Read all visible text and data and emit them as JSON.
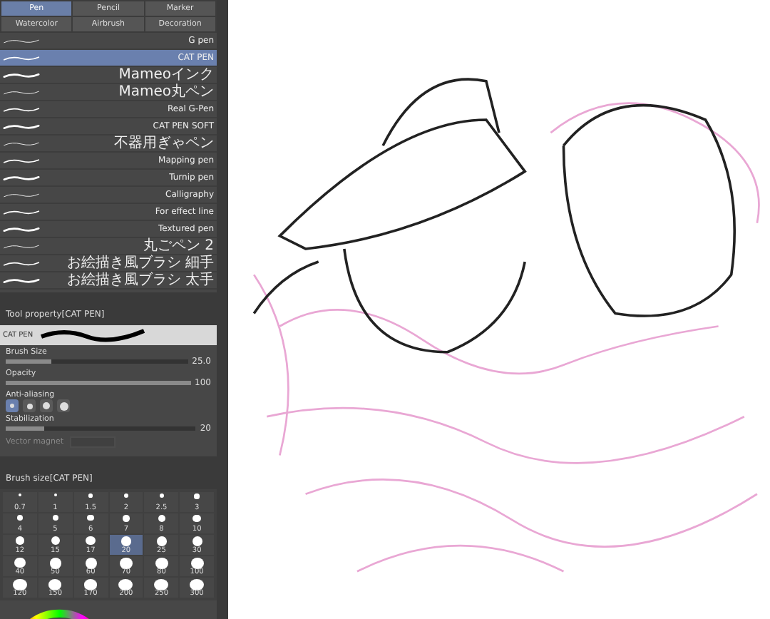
{
  "brush_tabs": [
    {
      "label": "Pen",
      "selected": true
    },
    {
      "label": "Pencil",
      "selected": false
    },
    {
      "label": "Marker",
      "selected": false
    },
    {
      "label": "Watercolor",
      "selected": false
    },
    {
      "label": "Airbrush",
      "selected": false
    },
    {
      "label": "Decoration",
      "selected": false
    }
  ],
  "brushes": [
    {
      "name": "G pen",
      "selected": false
    },
    {
      "name": "CAT PEN",
      "selected": true
    },
    {
      "name": "Mameoインク",
      "selected": false
    },
    {
      "name": "Mameo丸ペン",
      "selected": false
    },
    {
      "name": "Real G-Pen",
      "selected": false
    },
    {
      "name": "CAT PEN SOFT",
      "selected": false
    },
    {
      "name": "不器用ぎゃペン",
      "selected": false
    },
    {
      "name": "Mapping pen",
      "selected": false
    },
    {
      "name": "Turnip pen",
      "selected": false
    },
    {
      "name": "Calligraphy",
      "selected": false
    },
    {
      "name": "For effect line",
      "selected": false
    },
    {
      "name": "Textured pen",
      "selected": false
    },
    {
      "name": "丸ごペン 2",
      "selected": false
    },
    {
      "name": "お絵描き風ブラシ 細手",
      "selected": false
    },
    {
      "name": "お絵描き風ブラシ 太手",
      "selected": false
    }
  ],
  "tool_property": {
    "title": "Tool property[CAT PEN]",
    "preview_label": "CAT PEN",
    "rows": [
      {
        "kind": "slider",
        "label": "Brush Size",
        "value": "25.0",
        "level": 0.25
      },
      {
        "kind": "slider",
        "label": "Opacity",
        "value": "100",
        "level": 1
      },
      {
        "kind": "choice",
        "label": "Anti-aliasing",
        "options": [
          {
            "selected": true
          },
          {
            "selected": false
          },
          {
            "selected": false
          },
          {
            "selected": false
          }
        ]
      },
      {
        "kind": "slider",
        "label": "Stabilization",
        "value": "20",
        "level": 0.2
      },
      {
        "kind": "toggle",
        "label": "Vector magnet",
        "disabled": true
      }
    ]
  },
  "brush_size": {
    "title": "Brush size[CAT PEN]",
    "sizes": [
      {
        "label": "0.7",
        "selected": false
      },
      {
        "label": "1",
        "selected": false
      },
      {
        "label": "1.5",
        "selected": false
      },
      {
        "label": "2",
        "selected": false
      },
      {
        "label": "2.5",
        "selected": false
      },
      {
        "label": "3",
        "selected": false
      },
      {
        "label": "4",
        "selected": false
      },
      {
        "label": "5",
        "selected": false
      },
      {
        "label": "6",
        "selected": false
      },
      {
        "label": "7",
        "selected": false
      },
      {
        "label": "8",
        "selected": false
      },
      {
        "label": "10",
        "selected": false
      },
      {
        "label": "12",
        "selected": false
      },
      {
        "label": "15",
        "selected": false
      },
      {
        "label": "17",
        "selected": false
      },
      {
        "label": "20",
        "selected": true
      },
      {
        "label": "25",
        "selected": false
      },
      {
        "label": "30",
        "selected": false
      },
      {
        "label": "40",
        "selected": false
      },
      {
        "label": "50",
        "selected": false
      },
      {
        "label": "60",
        "selected": false
      },
      {
        "label": "70",
        "selected": false
      },
      {
        "label": "80",
        "selected": false
      },
      {
        "label": "100",
        "selected": false
      },
      {
        "label": "120",
        "selected": false
      },
      {
        "label": "150",
        "selected": false
      },
      {
        "label": "170",
        "selected": false
      },
      {
        "label": "200",
        "selected": false
      },
      {
        "label": "250",
        "selected": false
      },
      {
        "label": "300",
        "selected": false
      }
    ]
  }
}
